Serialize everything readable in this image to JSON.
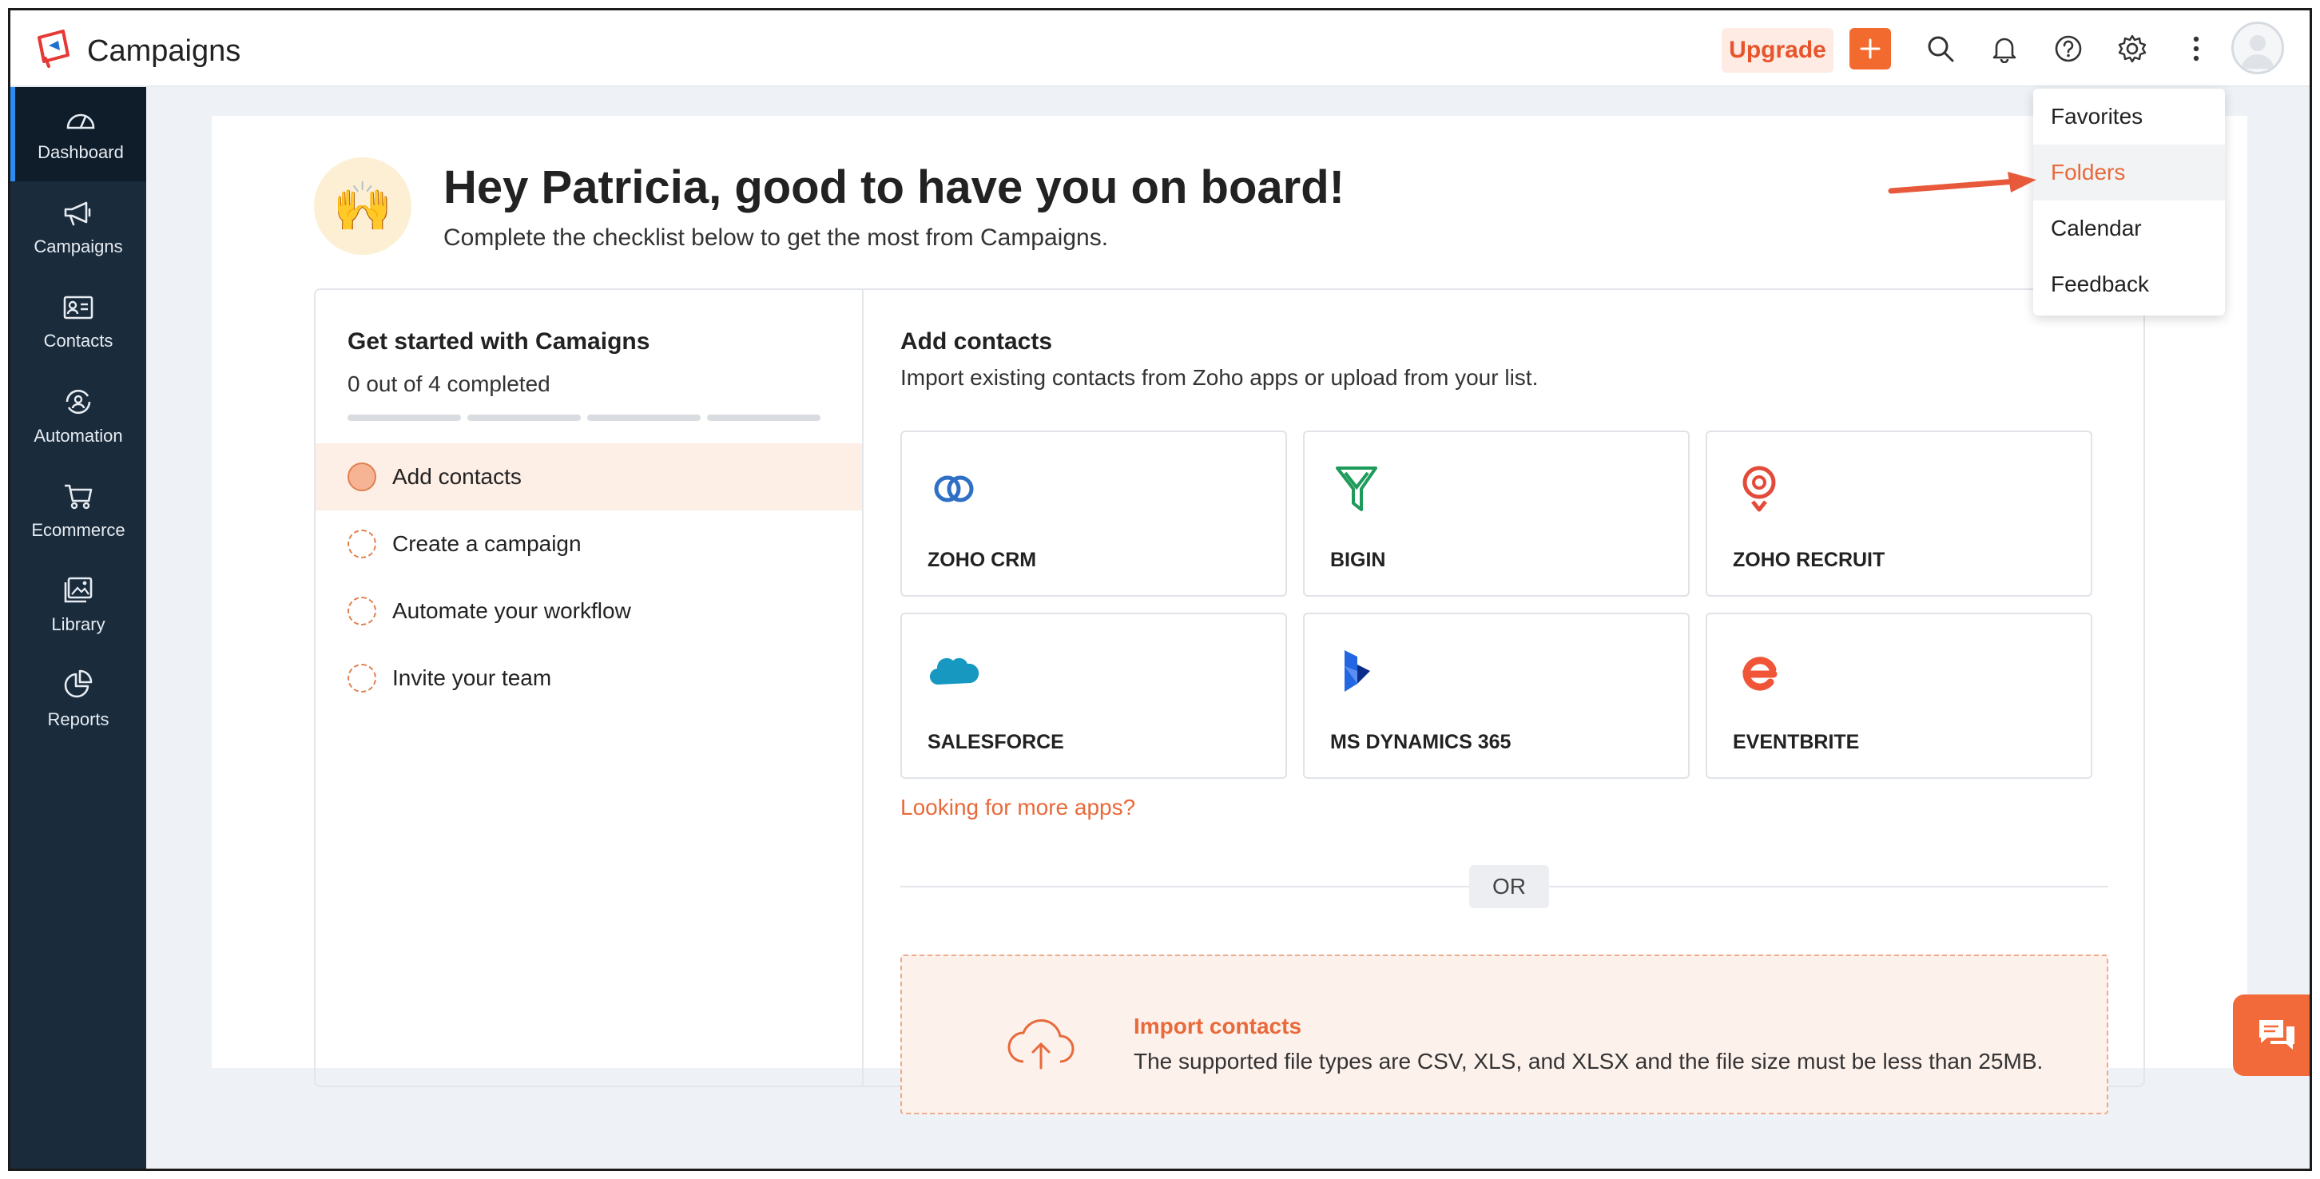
{
  "header": {
    "app_title": "Campaigns",
    "upgrade_label": "Upgrade",
    "icons": [
      "plus-icon",
      "search-icon",
      "bell-icon",
      "help-icon",
      "gear-icon",
      "more-vertical-icon",
      "avatar"
    ]
  },
  "sidebar": {
    "items": [
      {
        "label": "Dashboard",
        "icon": "dashboard-icon",
        "active": true
      },
      {
        "label": "Campaigns",
        "icon": "megaphone-icon"
      },
      {
        "label": "Contacts",
        "icon": "contact-card-icon"
      },
      {
        "label": "Automation",
        "icon": "automation-icon"
      },
      {
        "label": "Ecommerce",
        "icon": "cart-icon"
      },
      {
        "label": "Library",
        "icon": "library-icon"
      },
      {
        "label": "Reports",
        "icon": "pie-chart-icon"
      }
    ]
  },
  "welcome": {
    "emoji": "🙌",
    "title": "Hey Patricia, good to have you on board!",
    "subtitle": "Complete the checklist below to get the most from Campaigns."
  },
  "checklist": {
    "title": "Get started with Camaigns",
    "progress_text": "0 out of 4 completed",
    "completed": 0,
    "total": 4,
    "steps": [
      {
        "label": "Add contacts",
        "active": true
      },
      {
        "label": "Create a campaign"
      },
      {
        "label": "Automate your workflow"
      },
      {
        "label": "Invite your team"
      }
    ]
  },
  "add_contacts": {
    "title": "Add contacts",
    "subtitle": "Import existing contacts from Zoho apps or upload from your list.",
    "apps": [
      {
        "name": "ZOHO CRM",
        "icon": "zoho-crm-logo"
      },
      {
        "name": "BIGIN",
        "icon": "bigin-logo"
      },
      {
        "name": "ZOHO RECRUIT",
        "icon": "zoho-recruit-logo"
      },
      {
        "name": "SALESFORCE",
        "icon": "salesforce-logo"
      },
      {
        "name": "MS DYNAMICS 365",
        "icon": "ms-dynamics-logo"
      },
      {
        "name": "EVENTBRITE",
        "icon": "eventbrite-logo"
      }
    ],
    "more_apps_link": "Looking for more apps?",
    "or_label": "OR",
    "import": {
      "title": "Import contacts",
      "description": "The supported file types are CSV, XLS, and XLSX and the file size must be less than 25MB."
    }
  },
  "menu": {
    "items": [
      {
        "label": "Favorites"
      },
      {
        "label": "Folders",
        "highlighted": true
      },
      {
        "label": "Calendar"
      },
      {
        "label": "Feedback"
      }
    ]
  },
  "colors": {
    "accent": "#f26a2e",
    "sidebar_bg": "#1a2b3c",
    "link": "#e8693a"
  }
}
